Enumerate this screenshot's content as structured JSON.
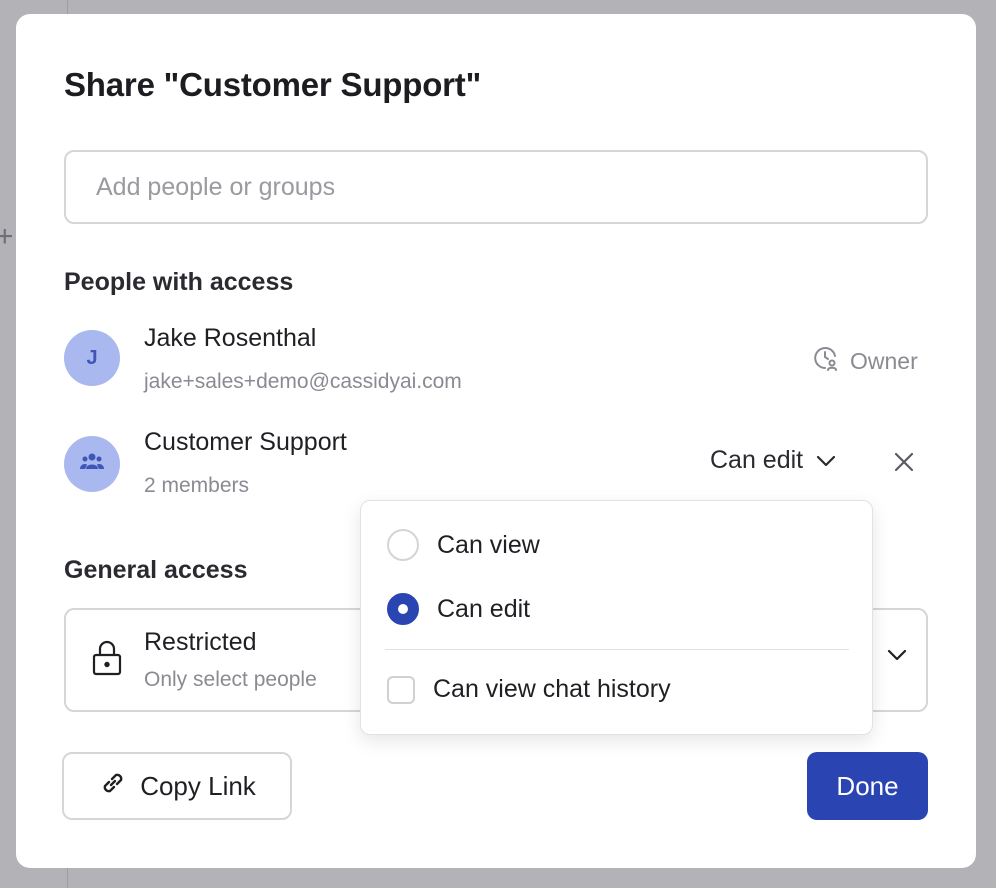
{
  "dialog": {
    "title": "Share \"Customer Support\"",
    "search_placeholder": "Add people or groups"
  },
  "people_section": {
    "heading": "People with access",
    "people": [
      {
        "initial": "J",
        "name": "Jake Rosenthal",
        "email": "jake+sales+demo@cassidyai.com",
        "role": "Owner",
        "role_icon": "clock-user-icon"
      },
      {
        "name": "Customer Support",
        "subtitle": "2 members",
        "role": "Can edit",
        "avatar_icon": "group-icon"
      }
    ]
  },
  "general_access": {
    "heading": "General access",
    "title": "Restricted",
    "subtitle": "Only select people"
  },
  "role_menu": {
    "options": [
      {
        "label": "Can view",
        "checked": false
      },
      {
        "label": "Can edit",
        "checked": true
      }
    ],
    "checkbox_label": "Can view chat history",
    "checkbox_checked": false
  },
  "footer": {
    "copy_label": "Copy Link",
    "done_label": "Done"
  },
  "colors": {
    "accent": "#2a45b2",
    "avatar_bg": "#a9b8ef",
    "backdrop": "#b3b2b7"
  }
}
